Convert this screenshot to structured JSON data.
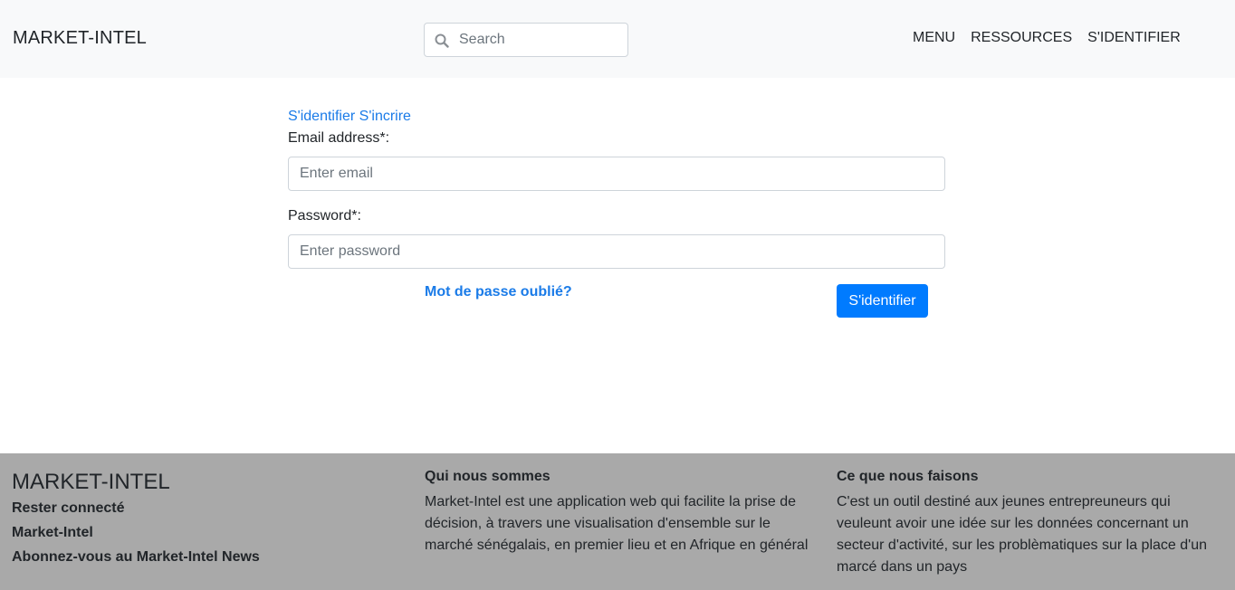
{
  "navbar": {
    "brand": "MARKET-INTEL",
    "search_placeholder": "Search",
    "links": [
      "MENU",
      "RESSOURCES",
      "S'IDENTIFIER"
    ]
  },
  "auth": {
    "tab_login": "S'identifier",
    "tab_register": "S'incrire",
    "email_label": "Email address*:",
    "email_placeholder": "Enter email",
    "password_label": "Password*:",
    "password_placeholder": "Enter password",
    "forgot_label": "Mot de passe oublié?",
    "submit_label": "S'identifier"
  },
  "footer": {
    "brand": "MARKET-INTEL",
    "links": [
      "Rester connecté",
      "Market-Intel",
      "Abonnez-vous au Market-Intel News"
    ],
    "about_heading": "Qui nous sommes",
    "about_text": "Market-Intel est une application web qui facilite la prise de décision, à travers une visualisation d'ensemble sur le marché sénégalais, en premier lieu et en Afrique en général",
    "what_heading": "Ce que nous faisons",
    "what_text": "C'est un outil destiné aux jeunes entrepreuneurs qui veuleunt avoir une idée sur les données concernant un secteur d'activité, sur les problèmatiques sur la place d'un marcé dans un pays"
  },
  "colors": {
    "navbar_bg": "#f8f9fa",
    "accent": "#007bff",
    "link": "#1a7be8",
    "footer_bg": "#a9a9a9"
  },
  "icons": {
    "search": "search-icon"
  }
}
